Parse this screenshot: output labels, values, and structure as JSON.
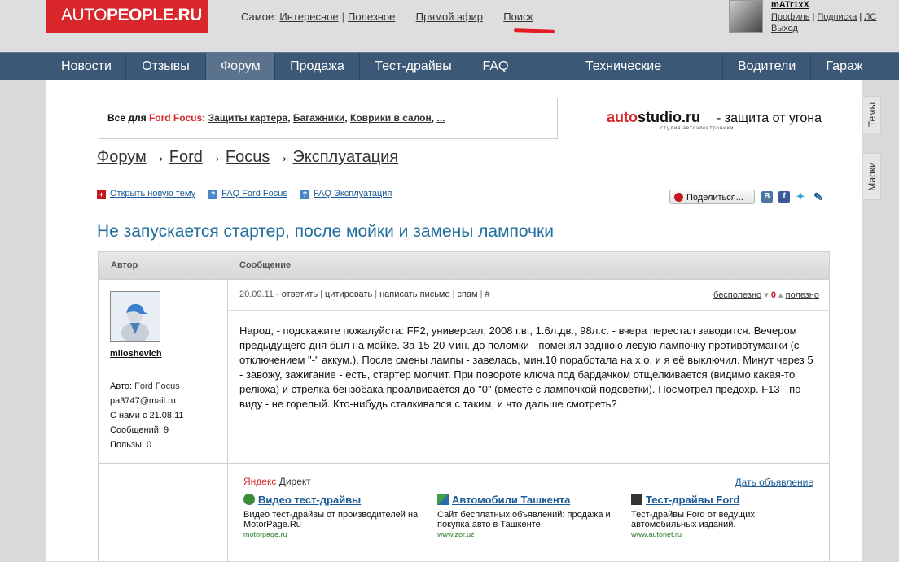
{
  "logo": {
    "part1": "AUTO",
    "part2": "PEOPLE.RU"
  },
  "topnav": {
    "label": "Самое:",
    "items": [
      "Интересное",
      "Полезное"
    ],
    "live": "Прямой эфир",
    "search": "Поиск",
    "search_underline_color": "#e31c23"
  },
  "user": {
    "name": "mATr1xX",
    "links": [
      "Профиль",
      "Подписка",
      "ЛС",
      "Выход"
    ]
  },
  "mainnav": {
    "items": [
      "Новости",
      "Отзывы",
      "Форум",
      "Продажа",
      "Тест-драйвы",
      "FAQ",
      "Технические характеристики",
      "Водители",
      "Гараж"
    ],
    "active": "Форум",
    "colors": {
      "bar": "#3b5876",
      "active": "#5a728c"
    }
  },
  "promo": {
    "prefix": "Все для",
    "brand": "Ford Focus",
    "links": [
      "Защиты картера",
      "Багажники",
      "Коврики в салон",
      "..."
    ]
  },
  "autostudio": {
    "logo1": "auto",
    "logo2": "studio.ru",
    "sub": "студия автоэлектроники",
    "tag": "- защита от угона"
  },
  "breadcrumb": {
    "items": [
      "Форум",
      "Ford",
      "Focus",
      "Эксплуатация"
    ],
    "arrow": "→"
  },
  "actions": {
    "new_topic": "Открыть новую тему",
    "faq_ford_focus": "FAQ Ford Focus",
    "faq_ekspluatatsiya": "FAQ Эксплуатация"
  },
  "share": {
    "label": "Поделиться...",
    "networks": [
      "vkontakte-icon",
      "facebook-icon",
      "twitter-icon",
      "livejournal-icon"
    ]
  },
  "title": "Не запускается стартер, после мойки и замены лампочки",
  "table": {
    "col_author": "Автор",
    "col_message": "Сообщение"
  },
  "author": {
    "name": "miloshevich",
    "car_label": "Авто:",
    "car": "Ford Focus",
    "email": "pa3747@mail.ru",
    "since": "С нами с 21.08.11",
    "messages": "Сообщений: 9",
    "useful": "Пользы: 0"
  },
  "message": {
    "date": "20.09.11 -",
    "actions": [
      "ответить",
      "цитировать",
      "написать письмо",
      "спам",
      "#"
    ],
    "useless": "бесполезно",
    "score": "0",
    "useful": "полезно",
    "text": "Народ, - подскажите пожалуйста: FF2, универсал, 2008 г.в., 1.6л.дв., 98л.с. - вчера перестал заводится. Вечером предыдущего дня был на мойке. За 15-20 мин. до поломки - поменял заднюю левую лампочку противотуманки (с отключением \"-\" аккум.). После смены лампы - завелась, мин.10 поработала на х.о. и я её выключил. Минут через 5 - завожу, зажигание - есть, стартер молчит. При повороте ключа под бардачком отщелкивается (видимо какая-то релюха) и стрелка бензобака проалвивается до \"0\" (вместе с лампочкой подсветки). Посмотрел предохр. F13 - по виду - не горелый.  Кто-нибудь сталкивался с таким, и что дальше смотреть?"
  },
  "ads": {
    "yandex": "Яндекс",
    "direct": "Директ",
    "give": "Дать объявление",
    "items": [
      {
        "title": "Видео тест-драйвы",
        "text": "Видео тест-драйвы от производителей на MotorPage.Ru",
        "url": "motorpage.ru",
        "icon": "motorpage-icon"
      },
      {
        "title": "Автомобили Ташкента",
        "text": "Сайт бесплатных объявлений: продажа и покупка авто в Ташкенте.",
        "url": "www.zor.uz",
        "icon": "zor-icon"
      },
      {
        "title": "Тест-драйвы Ford",
        "text": "Тест-драйвы Ford от ведущих автомобильных изданий.",
        "url": "www.autonet.ru",
        "icon": "autonet-icon"
      }
    ]
  },
  "sidetabs": [
    "Темы",
    "Марки"
  ]
}
